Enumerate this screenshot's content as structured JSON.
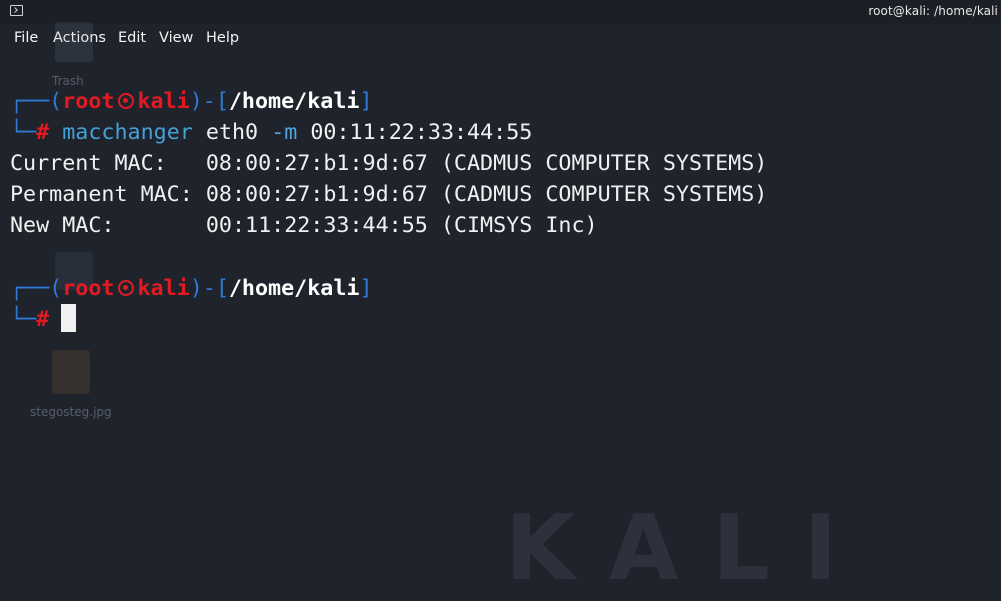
{
  "window": {
    "icon": "terminal-icon",
    "title": "root@kali: /home/kali"
  },
  "menu": {
    "items": [
      "File",
      "Actions",
      "Edit",
      "View",
      "Help"
    ]
  },
  "desktop_ghost": {
    "labels": [
      "Trash",
      "stegosteg.jpg"
    ]
  },
  "prompt": {
    "open_paren": "┌──(",
    "user": "root",
    "host": "kali",
    "close_mid": ")-[",
    "path": "/home/kali",
    "close_bracket": "]",
    "corner": "└─",
    "hash": "#"
  },
  "command": {
    "program": "macchanger",
    "arg1": "eth0",
    "flag": "-m",
    "arg2": "00:11:22:33:44:55"
  },
  "output": [
    "Current MAC:   08:00:27:b1:9d:67 (CADMUS COMPUTER SYSTEMS)",
    "Permanent MAC: 08:00:27:b1:9d:67 (CADMUS COMPUTER SYSTEMS)",
    "New MAC:       00:11:22:33:44:55 (CIMSYS Inc)"
  ],
  "colors": {
    "background": "#1f232c",
    "prompt_blue": "#2f7ad8",
    "prompt_red": "#e21b23",
    "command_cyan": "#45a1d6"
  }
}
